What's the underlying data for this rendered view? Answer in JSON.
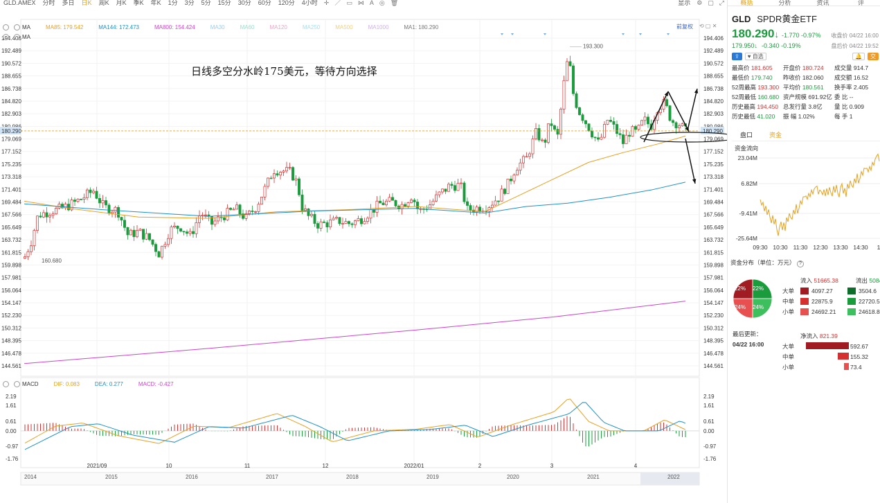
{
  "toolbar": {
    "symbol": "GLD.AMEX",
    "periods": [
      "分时",
      "多日",
      "日K",
      "周K",
      "月K",
      "季K",
      "年K",
      "1分",
      "3分",
      "5分",
      "15分",
      "30分",
      "60分",
      "120分",
      "4小时"
    ],
    "active_period": "日K",
    "display_label": "显示"
  },
  "ma": {
    "label": "MA",
    "ma85": "MA85: 179.542",
    "ma144": "MA144: 172.473",
    "ma800": "MA800: 154.424",
    "ma30": "MA30",
    "ma60": "MA60",
    "ma120": "MA120",
    "ma250": "MA250",
    "ma500": "MA500",
    "ma1000": "MA1000",
    "ma1": "MA1: 180.290",
    "fq": "前复权",
    "second": "MA"
  },
  "macd": {
    "label": "MACD",
    "dif": "DIF: 0.083",
    "dea": "DEA: 0.277",
    "macd": "MACD: -0.427"
  },
  "annotation": "日线多空分水岭175美元，等待方向选择",
  "colors": {
    "up": "#d43030",
    "down": "#1a9b3c",
    "ma85": "#e8a020",
    "ma144": "#1e90c8",
    "ma800": "#cc44cc",
    "dif": "#e8a020",
    "dea": "#1e90c8"
  },
  "chart_data": {
    "type": "candlestick",
    "price_axis": [
      "194.406",
      "192.489",
      "190.572",
      "188.655",
      "186.738",
      "184.820",
      "182.903",
      "180.986",
      "179.069",
      "177.152",
      "175.235",
      "173.318",
      "171.401",
      "169.484",
      "167.566",
      "165.649",
      "163.732",
      "161.815",
      "159.898",
      "157.981",
      "156.064",
      "154.147",
      "152.230",
      "150.312",
      "148.395",
      "146.478",
      "144.561"
    ],
    "last_price": "180.290",
    "high_label": "193.300",
    "low_label": "160.680",
    "macd_axis": [
      "2.19",
      "1.61",
      "0.61",
      "0.00",
      "-0.97",
      "-1.76"
    ],
    "x_labels": [
      "2021/09",
      "10",
      "11",
      "12",
      "2022/01",
      "2",
      "3",
      "4"
    ],
    "timeline_labels": [
      "2014",
      "2015",
      "2016",
      "2017",
      "2018",
      "2019",
      "2020",
      "2021",
      "2022"
    ]
  },
  "panel": {
    "tabs": [
      "概括",
      "分析",
      "资讯",
      "评"
    ],
    "code": "GLD",
    "name": "SPDR黄金ETF",
    "price": "180.290",
    "arrow": "↓",
    "change": "-1.770 -0.97%",
    "close_time": "收盘价 04/22 16:00",
    "post_price": "179.950↓",
    "post_change": "-0.340 -0.19%",
    "post_time": "盘后价 04/22 19:52",
    "fav": "自选",
    "trade": "交",
    "stats": [
      [
        "最高价",
        "181.605",
        "red"
      ],
      [
        "开盘价",
        "180.724",
        "red"
      ],
      [
        "成交量",
        "914.7",
        ""
      ],
      [
        "最低价",
        "179.740",
        "green"
      ],
      [
        "昨收价",
        "182.060",
        ""
      ],
      [
        "成交额",
        "16.52",
        ""
      ],
      [
        "52周最高",
        "193.300",
        "red"
      ],
      [
        "平均价",
        "180.561",
        "green"
      ],
      [
        "换手率",
        "2.405",
        ""
      ],
      [
        "52周最低",
        "160.680",
        "green"
      ],
      [
        "资产规模",
        "691.92亿",
        ""
      ],
      [
        "委",
        "比 --",
        ""
      ],
      [
        "历史最高",
        "194.450",
        "red"
      ],
      [
        "总发行量",
        "3.8亿",
        ""
      ],
      [
        "量",
        "比 0.909",
        ""
      ],
      [
        "历史最低",
        "41.020",
        "green"
      ],
      [
        "振",
        "幅 1.02%",
        ""
      ],
      [
        "每",
        "手 1",
        ""
      ]
    ],
    "sub_tabs": [
      "盘口",
      "资金"
    ],
    "flow_title": "资金流向",
    "flow_axis": [
      "23.04M",
      "6.82M",
      "-9.41M",
      "-25.64M"
    ],
    "flow_times": [
      "09:30",
      "10:30",
      "11:30",
      "12:30",
      "13:30",
      "14:30",
      "1"
    ],
    "dist_title": "资金分布（单位：万元）",
    "pie": [
      "22%",
      "22%",
      "24%",
      "24%"
    ],
    "inflow_label": "流入",
    "inflow": "51665.38",
    "outflow_label": "流出",
    "outflow": "50843.9",
    "rows": [
      {
        "lbl": "大单",
        "in": "4097.27",
        "out": "3504.6"
      },
      {
        "lbl": "中单",
        "in": "22875.9",
        "out": "22720.5"
      },
      {
        "lbl": "小单",
        "in": "24692.21",
        "out": "24618.8"
      }
    ],
    "net_label": "净流入",
    "net": "821.39",
    "net_rows": [
      {
        "lbl": "大单",
        "val": "592.67",
        "frac": 1.0
      },
      {
        "lbl": "中单",
        "val": "155.32",
        "frac": 0.26
      },
      {
        "lbl": "小单",
        "val": "73.4",
        "frac": 0.12
      }
    ],
    "last_update_label": "最后更新：",
    "last_update": "04/22 16:00"
  }
}
